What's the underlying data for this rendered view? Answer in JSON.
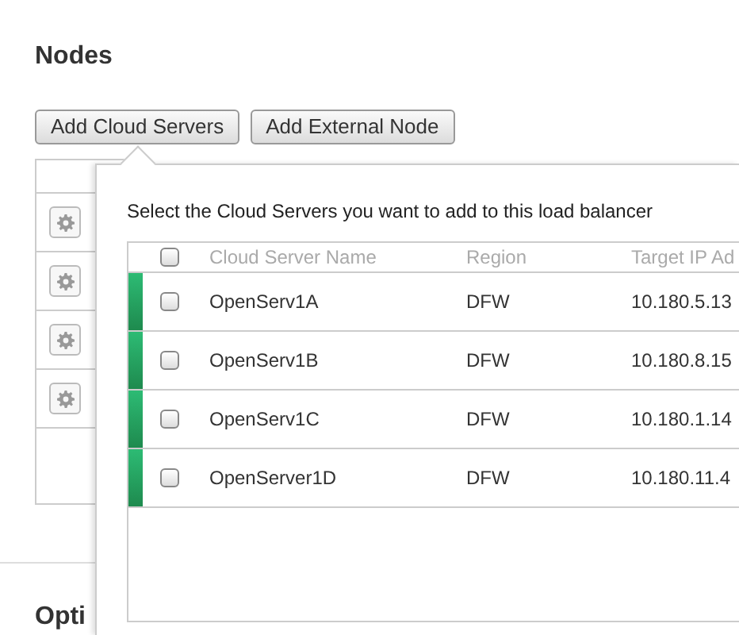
{
  "heading": "Nodes",
  "buttons": [
    "Add Cloud Servers",
    "Add External Node"
  ],
  "next_heading": "Opti",
  "popover": {
    "prompt": "Select the Cloud Servers you want to add to this load balancer",
    "select_all": {
      "checked": false
    },
    "columns": [
      "Cloud Server Name",
      "Region",
      "Target IP Ad"
    ],
    "rows": [
      {
        "checked": false,
        "name": "OpenServ1A",
        "region": "DFW",
        "ip": "10.180.5.13"
      },
      {
        "checked": false,
        "name": "OpenServ1B",
        "region": "DFW",
        "ip": "10.180.8.15"
      },
      {
        "checked": false,
        "name": "OpenServ1C",
        "region": "DFW",
        "ip": "10.180.1.14"
      },
      {
        "checked": false,
        "name": "OpenServer1D",
        "region": "DFW",
        "ip": "10.180.11.4"
      }
    ]
  }
}
